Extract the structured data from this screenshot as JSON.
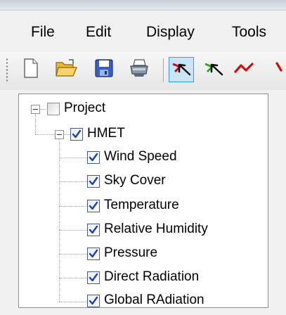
{
  "menubar": {
    "items": [
      {
        "label": "File"
      },
      {
        "label": "Edit"
      },
      {
        "label": "Display"
      },
      {
        "label": "Tools"
      }
    ]
  },
  "toolbar": {
    "buttons": [
      {
        "icon": "new-document-icon"
      },
      {
        "icon": "open-folder-icon"
      },
      {
        "icon": "save-icon"
      },
      {
        "icon": "print-icon"
      },
      {
        "icon": "select-arrow-icon",
        "active": true
      },
      {
        "icon": "select-arrow-green-icon"
      },
      {
        "icon": "red-line-tool-icon"
      }
    ]
  },
  "tree": {
    "root": {
      "label": "Project",
      "checked": false,
      "expanded": true
    },
    "group": {
      "label": "HMET",
      "checked": true,
      "expanded": true
    },
    "children": [
      {
        "label": "Wind Speed",
        "checked": true
      },
      {
        "label": "Sky Cover",
        "checked": true
      },
      {
        "label": "Temperature",
        "checked": true
      },
      {
        "label": "Relative Humidity",
        "checked": true
      },
      {
        "label": "Pressure",
        "checked": true
      },
      {
        "label": "Direct Radiation",
        "checked": true
      },
      {
        "label": "Global RAdiation",
        "checked": true
      }
    ]
  },
  "colors": {
    "checkmark": "#1c3fa8",
    "active_button_border": "#3399ff",
    "panel_border": "#8e8f8f"
  }
}
